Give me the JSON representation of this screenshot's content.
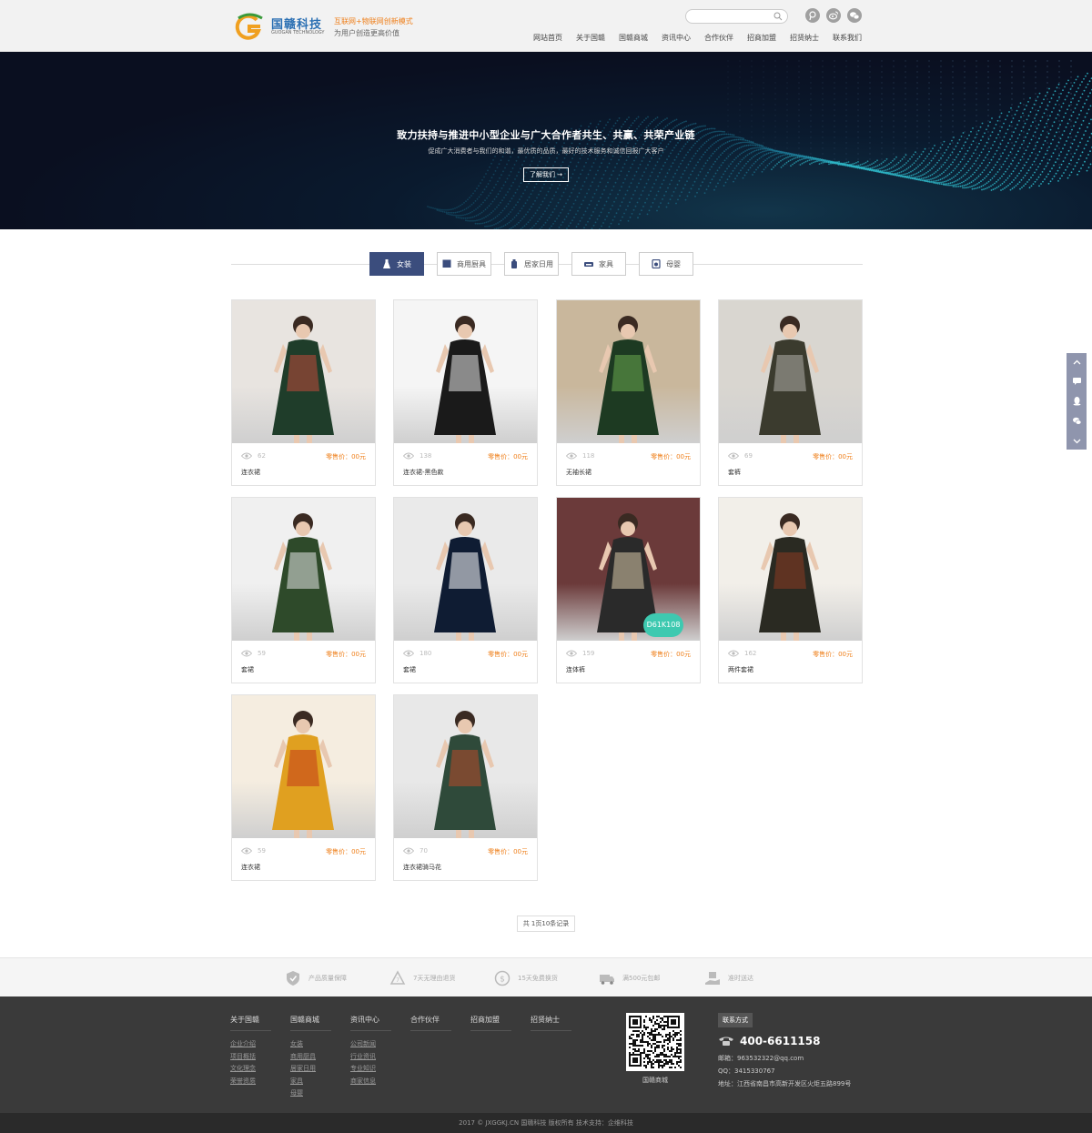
{
  "header": {
    "logo_cn": "国赣科技",
    "logo_en": "GUOGAN TECHNOLOGY",
    "slogan_line1": "互联网+物联网创新模式",
    "slogan_line2": "为用户创造更高价值",
    "search_placeholder": "",
    "social_icons": [
      "tencent-weibo-icon",
      "weibo-icon",
      "wechat-icon"
    ],
    "nav": [
      "网站首页",
      "关于国赣",
      "国赣商城",
      "资讯中心",
      "合作伙伴",
      "招商加盟",
      "招贤纳士",
      "联系我们"
    ]
  },
  "banner": {
    "title": "致力扶持与推进中小型企业与广大合作者共生、共赢、共荣产业链",
    "subtitle": "促成广大消费者与我们的和谐，最优质的品质，最好的技术服务和诚信回报广大客户",
    "button": "了解我们 →"
  },
  "tabs": [
    {
      "label": "女装",
      "icon": "dress-icon",
      "active": true
    },
    {
      "label": "商用厨具",
      "icon": "stove-icon",
      "active": false
    },
    {
      "label": "居家日用",
      "icon": "bottle-icon",
      "active": false
    },
    {
      "label": "家具",
      "icon": "sofa-icon",
      "active": false
    },
    {
      "label": "母婴",
      "icon": "baby-icon",
      "active": false
    }
  ],
  "products": [
    {
      "name": "连衣裙",
      "views": "62",
      "price": "零售价：00元",
      "palette": [
        "#1f3d2a",
        "#c04a3a",
        "#e8e4e0"
      ]
    },
    {
      "name": "连衣裙-黑色款",
      "views": "138",
      "price": "零售价：00元",
      "palette": [
        "#1a1a1a",
        "#e8e8e8",
        "#f5f5f5"
      ]
    },
    {
      "name": "无袖长裙",
      "views": "118",
      "price": "零售价：00元",
      "palette": [
        "#1d3a22",
        "#6aa84f",
        "#c9b79c"
      ]
    },
    {
      "name": "套裤",
      "views": "69",
      "price": "零售价：00元",
      "palette": [
        "#3b3b2e",
        "#b0aea9",
        "#d9d6d0"
      ]
    },
    {
      "name": "套裙",
      "views": "59",
      "price": "零售价：00元",
      "palette": [
        "#2e4a2a",
        "#e5e5e5",
        "#f0f0f0"
      ]
    },
    {
      "name": "套裙",
      "views": "180",
      "price": "零售价：00元",
      "palette": [
        "#0f1c33",
        "#ffffff",
        "#eaeaea"
      ]
    },
    {
      "name": "连体裤",
      "views": "159",
      "price": "零售价：00元",
      "palette": [
        "#2a2a2a",
        "#d8c8a8",
        "#6b3a3a"
      ]
    },
    {
      "name": "两件套裙",
      "views": "162",
      "price": "零售价：00元",
      "palette": [
        "#2a2a22",
        "#8b3a22",
        "#f2efe9"
      ]
    },
    {
      "name": "连衣裙",
      "views": "59",
      "price": "零售价：00元",
      "palette": [
        "#e0a020",
        "#c23a1a",
        "#f5ede0"
      ]
    },
    {
      "name": "连衣裙骑马花",
      "views": "70",
      "price": "零售价：00元",
      "palette": [
        "#2f4a3a",
        "#b84a2a",
        "#e8e8e8"
      ]
    }
  ],
  "watermark_text": "D61K108",
  "pager": "共 1页10条记录",
  "services": [
    {
      "icon": "shield-icon",
      "label": "产品质量保障"
    },
    {
      "icon": "recycle-icon",
      "label": "7天无理由退货"
    },
    {
      "icon": "dollar-icon",
      "label": "15天免费换货"
    },
    {
      "icon": "truck-icon",
      "label": "满500元包邮"
    },
    {
      "icon": "delivery-icon",
      "label": "准时送达"
    }
  ],
  "footer": {
    "columns": [
      {
        "title": "关于国赣",
        "links": [
          "企业介绍",
          "项目概括",
          "文化理念",
          "荣誉资质"
        ]
      },
      {
        "title": "国赣商城",
        "links": [
          "女装",
          "商用厨具",
          "居家日用",
          "家具",
          "母婴"
        ]
      },
      {
        "title": "资讯中心",
        "links": [
          "公司新闻",
          "行业资讯",
          "专业知识",
          "商家信息"
        ]
      },
      {
        "title": "合作伙伴",
        "links": []
      },
      {
        "title": "招商加盟",
        "links": []
      },
      {
        "title": "招贤纳士",
        "links": []
      }
    ],
    "qr_label": "国赣商城",
    "contact_tag": "联系方式",
    "phone": "400-6611158",
    "email": "邮箱：963532322@qq.com",
    "qq": "QQ：3415330767",
    "address": "地址：江西省南昌市高新开发区火炬五路899号",
    "copyright": "2017 © JXGGKJ.CN 国赣科技 版权所有   技术支持：企维科技"
  },
  "colors": {
    "accent": "#3b4d7d",
    "price": "#ef7f1a",
    "footer_bg": "#3a3a3a",
    "banner_bg": "#0a0f20",
    "sidebar": "#8f95ad"
  }
}
